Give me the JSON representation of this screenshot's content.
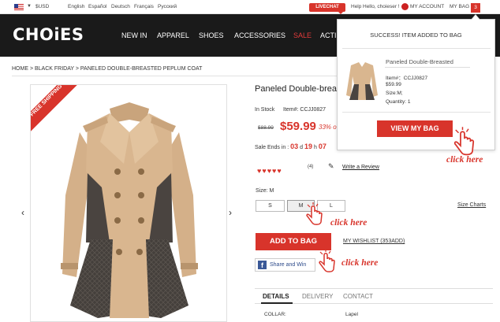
{
  "topbar": {
    "currency": "$USD",
    "languages": [
      "English",
      "Español",
      "Deutsch",
      "Français",
      "Русский"
    ],
    "livechat": "LIVECHAT",
    "help": "Help",
    "greeting": "Hello, choieser !",
    "my_account": "MY ACCOUNT",
    "my_bag": "MY BAG",
    "bag_count": "3"
  },
  "header": {
    "logo": "CHOiES",
    "nav": [
      "NEW IN",
      "APPAREL",
      "SHOES",
      "ACCESSORIES",
      "SALE",
      "ACTI"
    ]
  },
  "breadcrumb": "HOME > BLACK FRIDAY > PANELED DOUBLE-BREASTED PEPLUM COAT",
  "product": {
    "ribbon": "FREE SHIPPING",
    "title": "Paneled Double-breas",
    "stock": "In Stock",
    "item_no": "Item#: CCJJ0827",
    "old_price": "$88.99",
    "price": "$59.99",
    "off": "33% o",
    "sale_ends_label": "Sale Ends in :",
    "sale_d": "03",
    "sale_h": "19",
    "sale_m": "07",
    "rating_count": "(4)",
    "write_review": "Write a Review",
    "size_label": "Size: M",
    "sizes": [
      "S",
      "M",
      "L"
    ],
    "size_charts": "Size Charts",
    "add_to_bag": "ADD TO BAG",
    "wishlist": "MY WISHLIST (353ADD)",
    "share": "Share and Win",
    "tabs": [
      "DETAILS",
      "DELIVERY",
      "CONTACT"
    ],
    "detail_key": "COLLAR:",
    "detail_val": "Lapel"
  },
  "popup": {
    "success": "SUCCESS! ITEM ADDED TO BAG",
    "name": "Paneled Double-Breasted",
    "item": "Item#：CCJJ0827",
    "price": "$59.99",
    "size": "Size:M;",
    "quantity": "Quantity: 1",
    "view_bag": "VIEW MY BAG"
  },
  "annotations": {
    "click_here": "click here"
  },
  "colors": {
    "accent": "#d8342b",
    "header_bg": "#1a1a1a",
    "coat_beige": "#d9b68f",
    "coat_plaid": "#4a4440"
  }
}
